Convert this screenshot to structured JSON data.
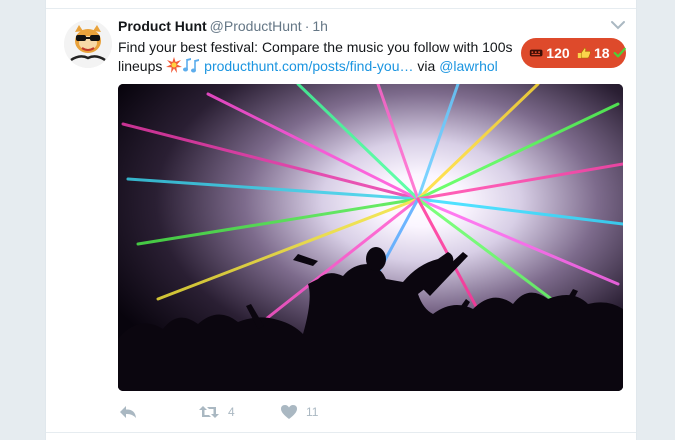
{
  "tweet": {
    "author_name": "Product Hunt",
    "handle": "@ProductHunt",
    "separator": "·",
    "time": "1h",
    "text_before": "Find your best festival: Compare the music you follow with 100s lineups ",
    "link_text": "producthunt.com/posts/find-you…",
    "text_via": " via ",
    "mention": "@lawrhol",
    "avatar_icon": "product-hunt-kitty-avatar",
    "media_alt": "concert crowd with colorful laser lights"
  },
  "badge": {
    "comments_count": "120",
    "upvotes_count": "18",
    "color": "#de4a2b"
  },
  "actions": {
    "reply_icon": "reply-icon",
    "retweet_count": "4",
    "like_count": "11"
  },
  "colors": {
    "link": "#1b95e0",
    "muted": "#657786",
    "action": "#aab8c2",
    "background": "#e6ecf0"
  }
}
